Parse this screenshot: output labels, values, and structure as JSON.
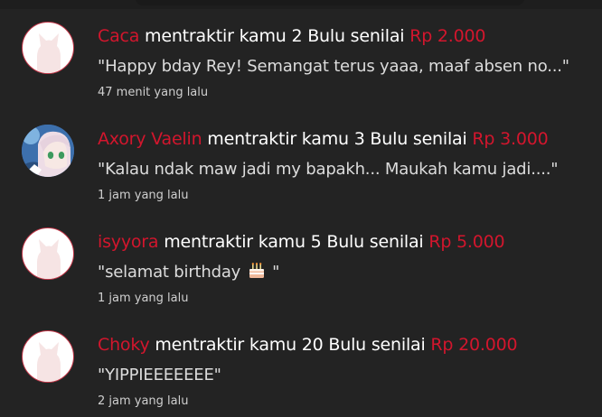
{
  "colors": {
    "background": "#232323",
    "accent_red": "#d2162d",
    "text_white": "#ffffff",
    "avatar_border": "#c4384a"
  },
  "feed": {
    "items": [
      {
        "avatar": "default-cat-avatar",
        "name": "Caca",
        "action": " mentraktir kamu 2 Bulu senilai ",
        "amount": "Rp 2.000",
        "message": "\"Happy bday Rey! Semangat terus yaaa, maaf absen no...\"",
        "time": "47 menit yang lalu"
      },
      {
        "avatar": "anime-girl-photo-avatar",
        "name": "Axory Vaelin",
        "action": " mentraktir kamu 3 Bulu senilai ",
        "amount": "Rp 3.000",
        "message": "\"Kalau ndak maw jadi my bapakh... Maukah kamu jadi....\"",
        "time": "1 jam yang lalu"
      },
      {
        "avatar": "default-cat-avatar",
        "name": "isyyora",
        "action": " mentraktir kamu 5 Bulu senilai ",
        "amount": "Rp 5.000",
        "message_before": "\"selamat birthday",
        "message_emoji": "birthday-cake-icon",
        "message_after": " \"",
        "time": "1 jam yang lalu"
      },
      {
        "avatar": "default-cat-avatar",
        "name": "Choky",
        "action": " mentraktir kamu 20 Bulu senilai ",
        "amount": "Rp 20.000",
        "message": "\"YIPPIEEEEEEE\"",
        "time": "2 jam yang lalu"
      }
    ]
  }
}
